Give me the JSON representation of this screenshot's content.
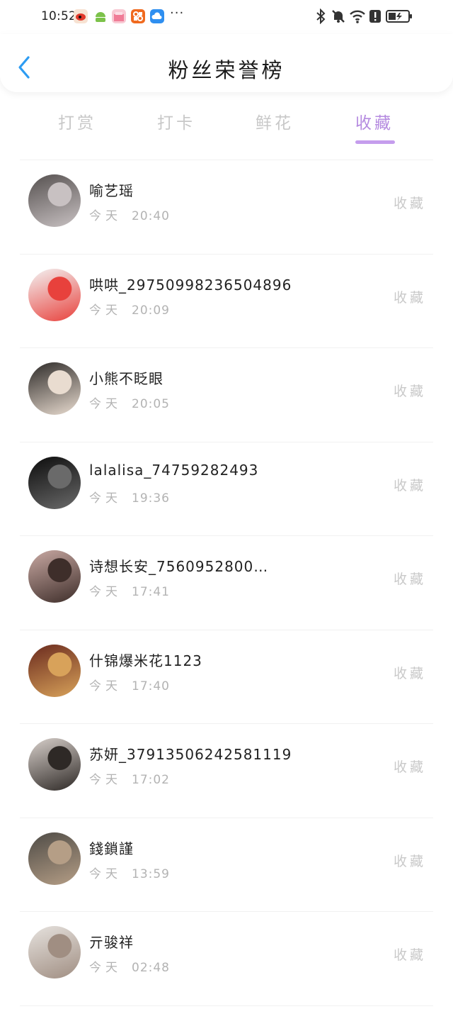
{
  "status_bar": {
    "time": "10:52",
    "apps": [
      {
        "icon": "weibo-icon",
        "color": "#f07a2c"
      },
      {
        "icon": "android-icon",
        "color": "#7cc24a"
      },
      {
        "icon": "shop-icon",
        "color": "#f58ca3"
      },
      {
        "icon": "app-grid-icon",
        "color": "#f06a1f"
      },
      {
        "icon": "cloud-icon",
        "color": "#3b8ef0"
      }
    ],
    "more": "···"
  },
  "header": {
    "title": "粉丝荣誉榜"
  },
  "tabs": [
    {
      "label": "打赏",
      "active": false
    },
    {
      "label": "打卡",
      "active": false
    },
    {
      "label": "鲜花",
      "active": false
    },
    {
      "label": "收藏",
      "active": true
    }
  ],
  "list": [
    {
      "name": "喻艺瑶",
      "day": "今天",
      "time": "20:40",
      "status": "收藏",
      "avatar_colors": [
        "#55504f",
        "#c8c1c2"
      ]
    },
    {
      "name": "哄哄_2975099823650489​6",
      "day": "今天",
      "time": "20:09",
      "status": "收藏",
      "avatar_colors": [
        "#f3f3f3",
        "#e8413c"
      ]
    },
    {
      "name": "小熊不眨眼",
      "day": "今天",
      "time": "20:05",
      "status": "收藏",
      "avatar_colors": [
        "#2d2a28",
        "#e9dcd0"
      ]
    },
    {
      "name": "lalalisa_74759282493",
      "day": "今天",
      "time": "19:36",
      "status": "收藏",
      "avatar_colors": [
        "#0c0c0c",
        "#6a6a6a"
      ]
    },
    {
      "name": "诗想长安_7560952800…",
      "day": "今天",
      "time": "17:41",
      "status": "收藏",
      "avatar_colors": [
        "#c9a9a3",
        "#3e2e2a"
      ]
    },
    {
      "name": "什锦爆米花1123",
      "day": "今天",
      "time": "17:40",
      "status": "收藏",
      "avatar_colors": [
        "#6a2a1e",
        "#d8a25a"
      ]
    },
    {
      "name": "苏妍_3791350624258​1119",
      "day": "今天",
      "time": "17:02",
      "status": "收藏",
      "avatar_colors": [
        "#d8d0cb",
        "#2e2926"
      ]
    },
    {
      "name": "錢鎖謹",
      "day": "今天",
      "time": "13:59",
      "status": "收藏",
      "avatar_colors": [
        "#4e4b46",
        "#b59e86"
      ]
    },
    {
      "name": "亓骏祥",
      "day": "今天",
      "time": "02:48",
      "status": "收藏",
      "avatar_colors": [
        "#e6e2de",
        "#a08e82"
      ]
    }
  ]
}
